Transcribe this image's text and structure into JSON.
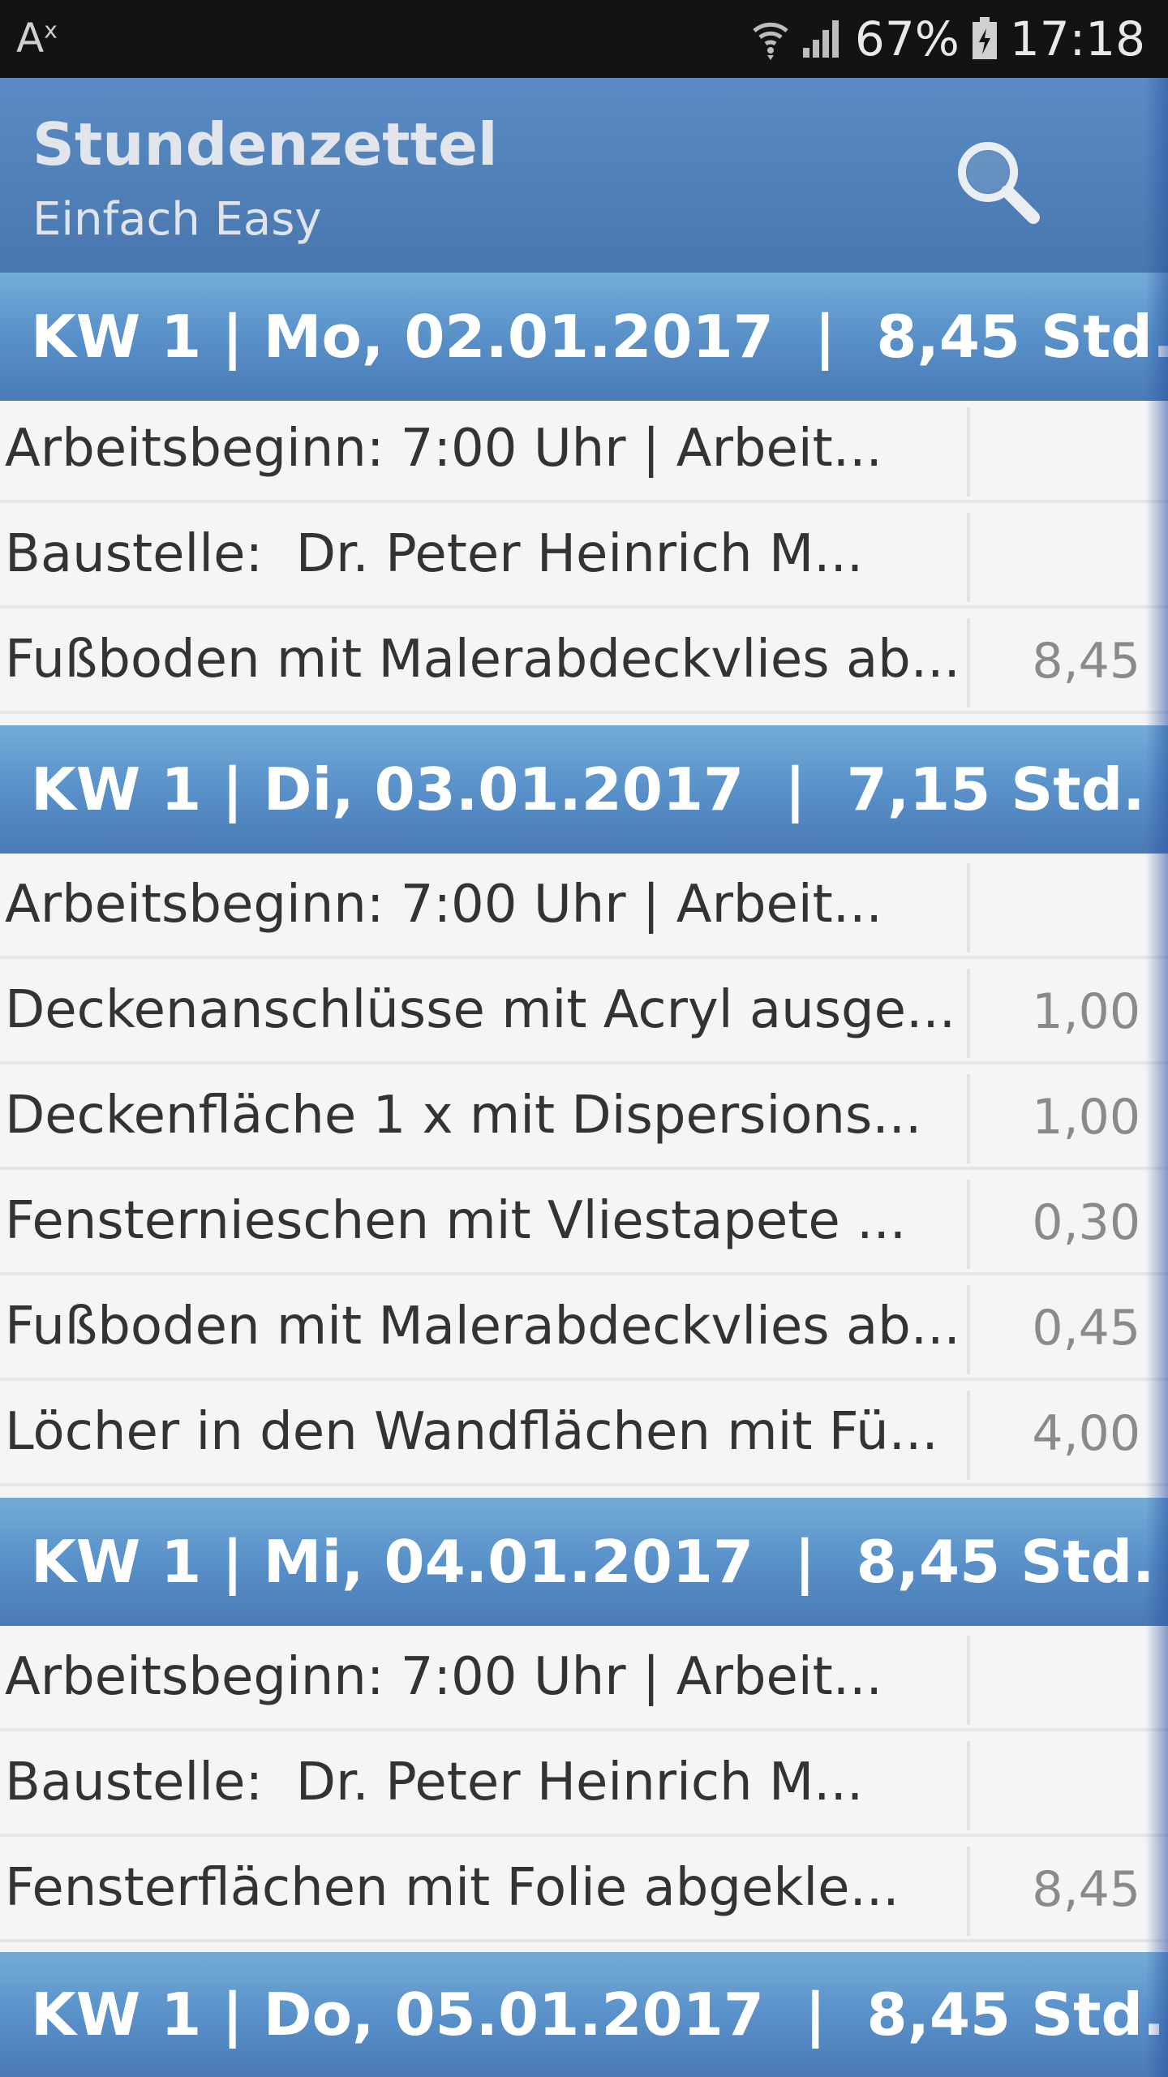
{
  "status_bar": {
    "left_label": "A",
    "left_sup": "x",
    "battery_percent": "67%",
    "time": "17:18"
  },
  "app_bar": {
    "title": "Stundenzettel",
    "subtitle": "Einfach Easy",
    "search_icon": "search-icon"
  },
  "days": [
    {
      "header": "KW 1 | Mo, 02.01.2017  |  8,45 Std.",
      "entries": [
        {
          "text": "Arbeitsbeginn: 7:00 Uhr | Arbeit...",
          "value": ""
        },
        {
          "text": "Baustelle:  Dr. Peter Heinrich M...",
          "value": ""
        },
        {
          "text": "Fußboden mit Malerabdeckvlies ab...",
          "value": "8,45"
        }
      ]
    },
    {
      "header": "KW 1 | Di, 03.01.2017  |  7,15 Std.",
      "entries": [
        {
          "text": "Arbeitsbeginn: 7:00 Uhr | Arbeit...",
          "value": ""
        },
        {
          "text": "Deckenanschlüsse mit Acryl ausge...",
          "value": "1,00"
        },
        {
          "text": "Deckenfläche 1 x mit Dispersions...",
          "value": "1,00"
        },
        {
          "text": "Fensternieschen mit Vliestapete ...",
          "value": "0,30"
        },
        {
          "text": "Fußboden mit Malerabdeckvlies ab...",
          "value": "0,45"
        },
        {
          "text": "Löcher in den Wandflächen mit Fü...",
          "value": "4,00"
        }
      ]
    },
    {
      "header": "KW 1 | Mi, 04.01.2017  |  8,45 Std.",
      "entries": [
        {
          "text": "Arbeitsbeginn: 7:00 Uhr | Arbeit...",
          "value": ""
        },
        {
          "text": "Baustelle:  Dr. Peter Heinrich M...",
          "value": ""
        },
        {
          "text": "Fensterflächen mit Folie abgekle...",
          "value": "8,45"
        }
      ]
    },
    {
      "header": "KW 1 | Do, 05.01.2017  |  8,45 Std.",
      "entries": []
    }
  ]
}
